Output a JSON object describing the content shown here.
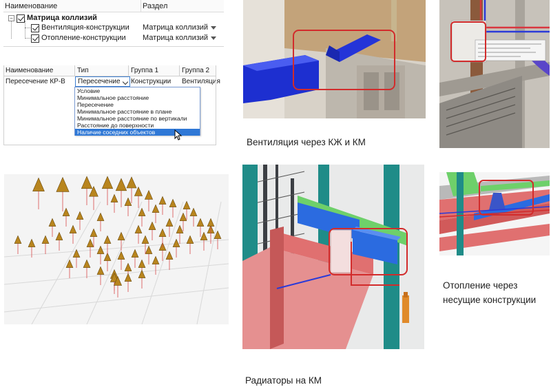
{
  "tree": {
    "col_name": "Наименование",
    "col_section": "Раздел",
    "root_label": "Матрица коллизий",
    "items": [
      {
        "label": "Вентиляция-конструкции",
        "section": "Матрица коллизий"
      },
      {
        "label": "Отопление-конструкции",
        "section": "Матрица коллизий"
      }
    ]
  },
  "grid": {
    "headers": [
      "Наименование",
      "Тип",
      "Группа 1",
      "Группа 2"
    ],
    "row": {
      "name": "Пересечение КР-В",
      "type": "Пересечение",
      "group1": "Конструкции",
      "group2": "Вентиляция"
    },
    "dropdown_options": [
      "Условие",
      "Минимальное расстояние",
      "Пересечение",
      "Минимальное расстояние в плане",
      "Минимальное расстояние по вертикали",
      "Расстояние до поверхности",
      "Наличие соседних объектов"
    ],
    "selected_option": "Наличие соседних объектов"
  },
  "captions": {
    "ventilation": "Вентиляция через КЖ и КМ",
    "heating_line1": "Отопление через",
    "heating_line2": "несущие конструкции",
    "radiators": "Радиаторы на КМ"
  },
  "colors": {
    "highlight_box": "#d22b2b",
    "duct_blue": "#1d2fd0",
    "beam_red": "#e07070",
    "beam_green": "#6ed06a",
    "column_teal": "#1f8c88",
    "selection_blue": "#2f78d6"
  }
}
